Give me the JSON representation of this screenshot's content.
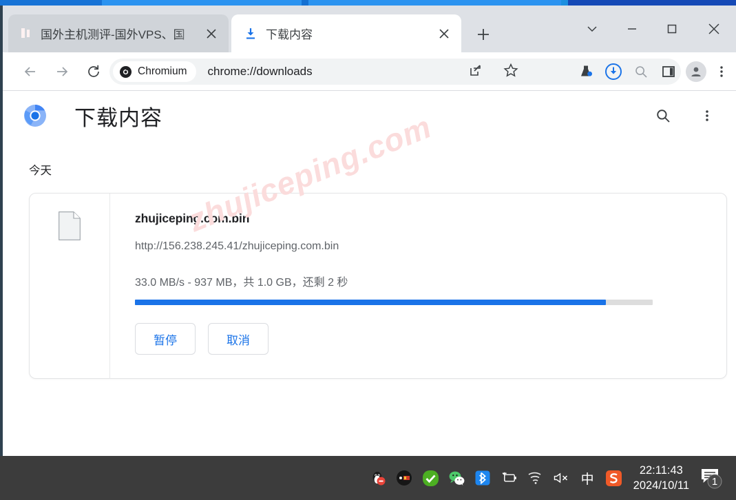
{
  "window": {
    "controls": {
      "tab_search": "chevron-down",
      "minimize": "minimize",
      "maximize": "maximize",
      "close": "close"
    }
  },
  "tabstrip": {
    "tabs": [
      {
        "title": "国外主机测评-国外VPS、国",
        "favicon": "red-site-favicon",
        "active": false,
        "close_label": "×"
      },
      {
        "title": "下载内容",
        "favicon": "download-icon",
        "active": true,
        "close_label": "×"
      }
    ],
    "new_tab_label": "+"
  },
  "toolbar": {
    "back_label": "←",
    "forward_label": "→",
    "reload_label": "reload-icon",
    "brand_chip": "Chromium",
    "url": "chrome://downloads",
    "icons": [
      "share-icon",
      "bookmark-star-icon",
      "experiments-flask-icon",
      "downloads-icon",
      "search-icon",
      "side-panel-icon",
      "profile-avatar-icon",
      "three-dot-menu-icon"
    ]
  },
  "page": {
    "logo": "chromium-logo",
    "title": "下载内容",
    "search_icon": "search-icon",
    "menu_icon": "three-dot-menu-icon",
    "date_group": "今天",
    "watermark": "zhujiceping.com",
    "item": {
      "file_icon": "generic-file-icon",
      "file_name": "zhujiceping.com.bin",
      "file_url": "http://156.238.245.41/zhujiceping.com.bin",
      "status": "33.0 MB/s - 937 MB，共 1.0 GB，还剩 2 秒",
      "progress_percent": 91,
      "pause_label": "暂停",
      "cancel_label": "取消"
    }
  },
  "taskbar": {
    "tray_icons": [
      "qq-penguin-icon",
      "dark-app-icon",
      "green-check-icon",
      "wechat-icon",
      "bluetooth-icon",
      "battery-charging-icon",
      "wifi-icon",
      "volume-muted-icon",
      "ime-chinese-icon",
      "sogou-input-icon"
    ],
    "ime_label": "中",
    "sogou_label": "S",
    "time": "22:11:43",
    "date": "2024/10/11",
    "notification_count": "1"
  },
  "colors": {
    "accent_blue": "#1a73e8",
    "tabstrip_bg": "#dee1e6",
    "taskbar_bg": "#3c3c3c",
    "watermark_pink": "#fbdcdc",
    "progress_track": "#dddddd"
  }
}
